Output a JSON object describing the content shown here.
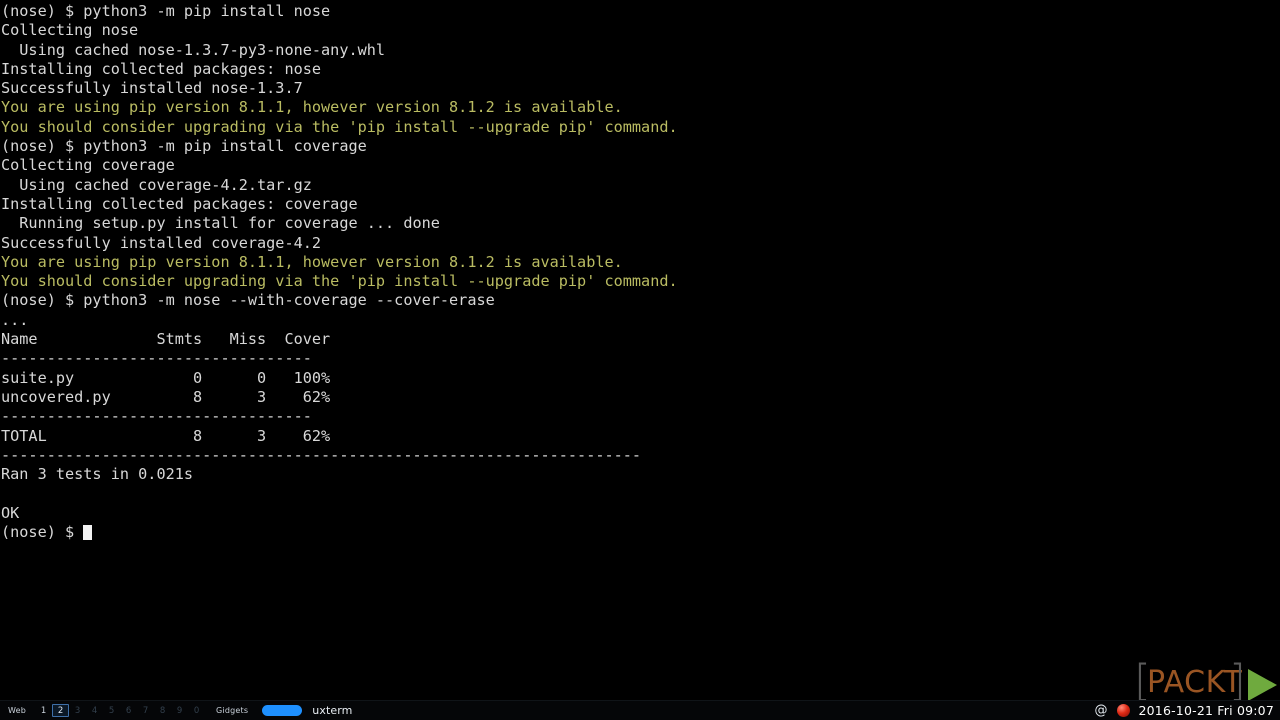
{
  "window": {
    "title": "uxterm"
  },
  "terminal": {
    "foreground": "#d8d8d8",
    "warning_color": "#babc62",
    "background": "#000000",
    "lines": [
      {
        "text": "(nose) $ python3 -m pip install nose",
        "style": "normal"
      },
      {
        "text": "Collecting nose",
        "style": "normal"
      },
      {
        "text": "  Using cached nose-1.3.7-py3-none-any.whl",
        "style": "normal"
      },
      {
        "text": "Installing collected packages: nose",
        "style": "normal"
      },
      {
        "text": "Successfully installed nose-1.3.7",
        "style": "normal"
      },
      {
        "text": "You are using pip version 8.1.1, however version 8.1.2 is available.",
        "style": "warn"
      },
      {
        "text": "You should consider upgrading via the 'pip install --upgrade pip' command.",
        "style": "warn"
      },
      {
        "text": "(nose) $ python3 -m pip install coverage",
        "style": "normal"
      },
      {
        "text": "Collecting coverage",
        "style": "normal"
      },
      {
        "text": "  Using cached coverage-4.2.tar.gz",
        "style": "normal"
      },
      {
        "text": "Installing collected packages: coverage",
        "style": "normal"
      },
      {
        "text": "  Running setup.py install for coverage ... done",
        "style": "normal"
      },
      {
        "text": "Successfully installed coverage-4.2",
        "style": "normal"
      },
      {
        "text": "You are using pip version 8.1.1, however version 8.1.2 is available.",
        "style": "warn"
      },
      {
        "text": "You should consider upgrading via the 'pip install --upgrade pip' command.",
        "style": "warn"
      },
      {
        "text": "(nose) $ python3 -m nose --with-coverage --cover-erase",
        "style": "normal"
      },
      {
        "text": "...",
        "style": "normal"
      },
      {
        "text": "Name             Stmts   Miss  Cover",
        "style": "normal"
      },
      {
        "text": "----------------------------------",
        "style": "normal"
      },
      {
        "text": "suite.py             0      0   100%",
        "style": "normal"
      },
      {
        "text": "uncovered.py         8      3    62%",
        "style": "normal"
      },
      {
        "text": "----------------------------------",
        "style": "normal"
      },
      {
        "text": "TOTAL                8      3    62%",
        "style": "normal"
      },
      {
        "text": "----------------------------------------------------------------------",
        "style": "normal"
      },
      {
        "text": "Ran 3 tests in 0.021s",
        "style": "normal"
      },
      {
        "text": "",
        "style": "blank"
      },
      {
        "text": "OK",
        "style": "normal"
      }
    ],
    "prompt": "(nose) $ ",
    "coverage_report": {
      "columns": [
        "Name",
        "Stmts",
        "Miss",
        "Cover"
      ],
      "rows": [
        {
          "name": "suite.py",
          "stmts": "0",
          "miss": "0",
          "cover": "100%"
        },
        {
          "name": "uncovered.py",
          "stmts": "8",
          "miss": "3",
          "cover": "62%"
        }
      ],
      "total": {
        "name": "TOTAL",
        "stmts": "8",
        "miss": "3",
        "cover": "62%"
      }
    },
    "test_summary": {
      "ran": "Ran 3 tests in 0.021s",
      "result": "OK"
    }
  },
  "logo": {
    "bracket_left": "[",
    "word": "PACKT",
    "bracket_right": "]",
    "word_color": "#9a5523",
    "bracket_color": "#5a5a5a",
    "triangle_color": "#6faa3e"
  },
  "taskbar": {
    "web_label": "Web",
    "workspaces": [
      {
        "label": "1",
        "state": "occupied"
      },
      {
        "label": "2",
        "state": "active"
      },
      {
        "label": "3",
        "state": "empty"
      },
      {
        "label": "4",
        "state": "empty"
      },
      {
        "label": "5",
        "state": "empty"
      },
      {
        "label": "6",
        "state": "empty"
      },
      {
        "label": "7",
        "state": "empty"
      },
      {
        "label": "8",
        "state": "empty"
      },
      {
        "label": "9",
        "state": "empty"
      },
      {
        "label": "0",
        "state": "empty"
      }
    ],
    "gidgets_label": "Gidgets",
    "window_title": "uxterm",
    "pill_color": "#1e90ff",
    "at_symbol": "@",
    "clock": "2016-10-21 Fri 09:07"
  }
}
